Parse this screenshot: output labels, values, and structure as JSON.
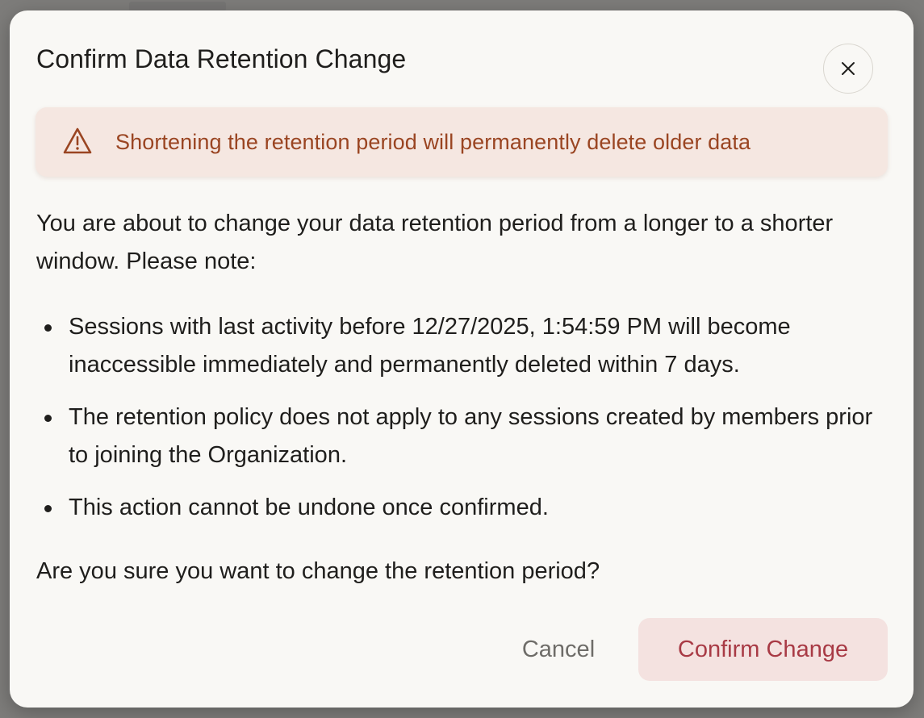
{
  "dialog": {
    "title": "Confirm Data Retention Change",
    "close_icon": "close-icon",
    "warning": {
      "icon": "warning-triangle-icon",
      "text": "Shortening the retention period will permanently delete older data",
      "color": "#9a4522",
      "background": "#f5e7e1"
    },
    "intro": "You are about to change your data retention period from a longer to a shorter window. Please note:",
    "bullets": [
      "Sessions with last activity before 12/27/2025, 1:54:59 PM will become inaccessible immediately and permanently deleted within 7 days.",
      "The retention policy does not apply to any sessions created by members prior to joining the Organization.",
      "This action cannot be undone once confirmed."
    ],
    "question": "Are you sure you want to change the retention period?",
    "buttons": {
      "cancel": "Cancel",
      "confirm": "Confirm Change"
    },
    "colors": {
      "confirm_text": "#a83a45",
      "confirm_background": "#f4e2e0"
    }
  }
}
